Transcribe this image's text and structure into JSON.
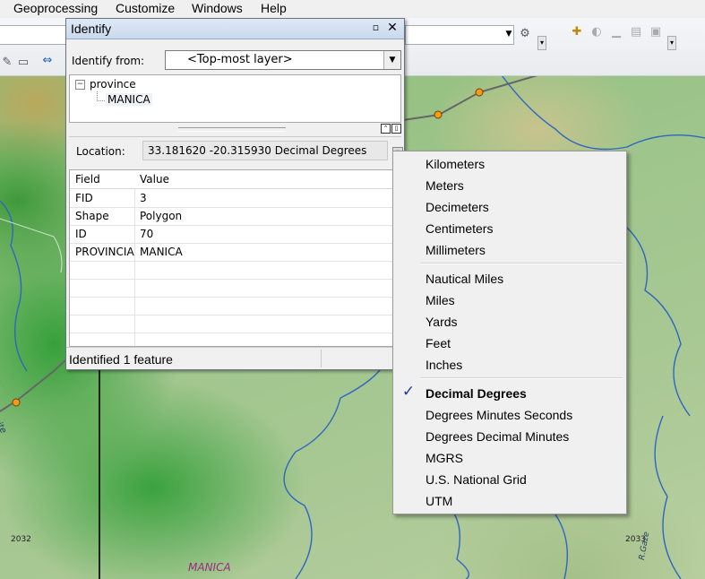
{
  "menubar": {
    "items": [
      "Geoprocessing",
      "Customize",
      "Windows",
      "Help"
    ]
  },
  "toolbar": {
    "icons": [
      "edit-icon",
      "comment-icon",
      "measure-icon",
      "settings-icon",
      "add-data-icon",
      "pan-icon",
      "graph-icon",
      "layer-icon",
      "tool-icon"
    ]
  },
  "identify": {
    "title": "Identify",
    "from_label": "Identify from:",
    "from_value": "<Top-most layer>",
    "tree": {
      "layer": "province",
      "feature": "MANICA"
    },
    "location_label": "Location:",
    "location_value": "33.181620  -20.315930 Decimal Degrees",
    "table": {
      "headers": [
        "Field",
        "Value"
      ],
      "rows": [
        [
          "FID",
          "3"
        ],
        [
          "Shape",
          "Polygon"
        ],
        [
          "ID",
          "70"
        ],
        [
          "PROVINCIA",
          "MANICA"
        ]
      ]
    },
    "status": "Identified 1 feature"
  },
  "units_menu": {
    "groups": [
      [
        "Kilometers",
        "Meters",
        "Decimeters",
        "Centimeters",
        "Millimeters"
      ],
      [
        "Nautical Miles",
        "Miles",
        "Yards",
        "Feet",
        "Inches"
      ],
      [
        "Decimal Degrees",
        "Degrees Minutes Seconds",
        "Degrees Decimal Minutes",
        "MGRS",
        "U.S. National Grid",
        "UTM"
      ]
    ],
    "checked": "Decimal Degrees",
    "accent_color": "#1b3fa0"
  },
  "map": {
    "labels": {
      "province": "MANICA",
      "grid_left": "2032",
      "grid_right": "2033",
      "river_left": "Lucite",
      "river_right": "R.Gaze"
    },
    "colors": {
      "terrain": "#9ec58c",
      "river": "#2f66c2",
      "road": "#666666",
      "boundary": "#222222"
    }
  }
}
